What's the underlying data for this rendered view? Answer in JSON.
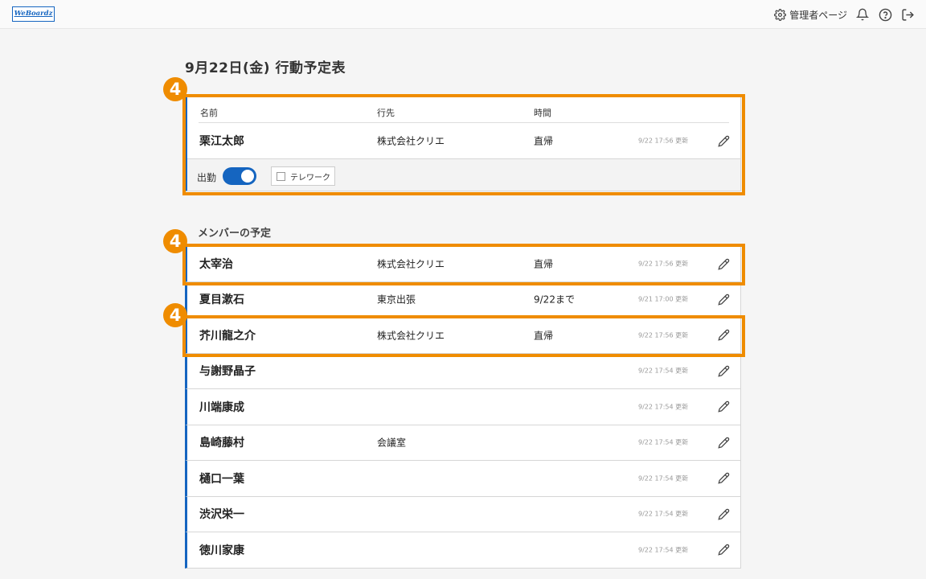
{
  "app": {
    "logo_text": "WeBoardz",
    "admin_label": "管理者ページ",
    "icons": {
      "settings": "gear-icon",
      "bell": "bell-icon",
      "help": "help-icon",
      "logout": "logout-icon"
    }
  },
  "page": {
    "title": "9月22日(金) 行動予定表"
  },
  "my_schedule": {
    "headers": {
      "name": "名前",
      "destination": "行先",
      "time": "時間"
    },
    "name": "栗江太郎",
    "destination": "株式会社クリエ",
    "time": "直帰",
    "updated": "9/22 17:56 更新",
    "attendance_label": "出勤",
    "attendance_on": true,
    "telework_label": "テレワーク",
    "telework_checked": false
  },
  "members_section": {
    "title": "メンバーの予定",
    "rows": [
      {
        "name": "太宰治",
        "destination": "株式会社クリエ",
        "time": "直帰",
        "updated": "9/22 17:56 更新"
      },
      {
        "name": "夏目漱石",
        "destination": "東京出張",
        "time": "9/22まで",
        "updated": "9/21 17:00 更新"
      },
      {
        "name": "芥川龍之介",
        "destination": "株式会社クリエ",
        "time": "直帰",
        "updated": "9/22 17:56 更新"
      },
      {
        "name": "与謝野晶子",
        "destination": "",
        "time": "",
        "updated": "9/22 17:54 更新"
      },
      {
        "name": "川端康成",
        "destination": "",
        "time": "",
        "updated": "9/22 17:54 更新"
      },
      {
        "name": "島崎藤村",
        "destination": "会議室",
        "time": "",
        "updated": "9/22 17:54 更新"
      },
      {
        "name": "樋口一葉",
        "destination": "",
        "time": "",
        "updated": "9/22 17:54 更新"
      },
      {
        "name": "渋沢栄一",
        "destination": "",
        "time": "",
        "updated": "9/22 17:54 更新"
      },
      {
        "name": "徳川家康",
        "destination": "",
        "time": "",
        "updated": "9/22 17:54 更新"
      }
    ]
  },
  "annotations": {
    "step_badge": "4",
    "color": "#ef8c00"
  }
}
